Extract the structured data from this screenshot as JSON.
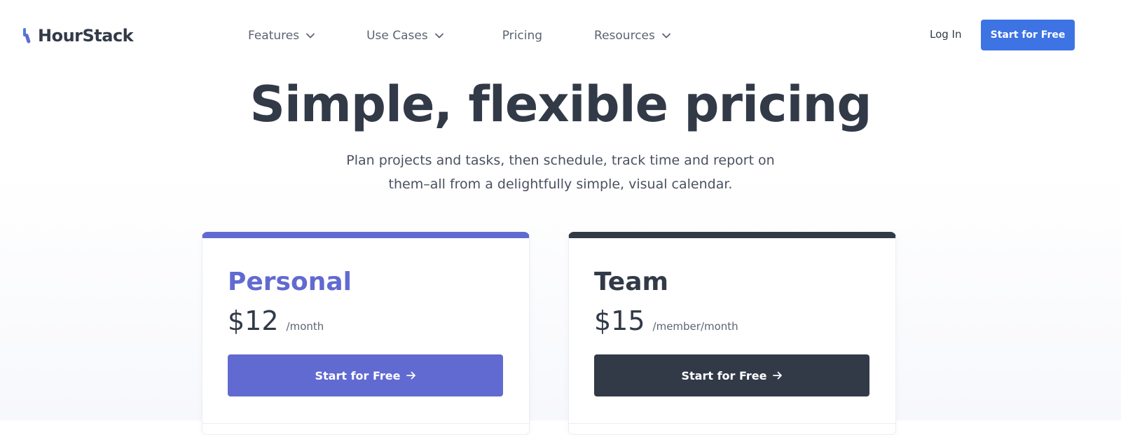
{
  "header": {
    "logo_text": "HourStack",
    "nav": [
      {
        "label": "Features",
        "has_dropdown": true
      },
      {
        "label": "Use Cases",
        "has_dropdown": true
      },
      {
        "label": "Pricing",
        "has_dropdown": false
      },
      {
        "label": "Resources",
        "has_dropdown": true
      }
    ],
    "login_label": "Log In",
    "cta_label": "Start for Free"
  },
  "hero": {
    "title": "Simple, flexible pricing",
    "subtitle_line1": "Plan projects and tasks, then schedule, track time and report on",
    "subtitle_line2": "them–all from a delightfully simple, visual calendar."
  },
  "plans": [
    {
      "name": "Personal",
      "price": "$12",
      "period": "/month",
      "button_label": "Start for Free",
      "accent": "#616ad1"
    },
    {
      "name": "Team",
      "price": "$15",
      "period": "/member/month",
      "button_label": "Start for Free",
      "accent": "#323a48"
    }
  ],
  "colors": {
    "brand_blue": "#3e73e4",
    "personal_accent": "#616ad1",
    "team_accent": "#323a48",
    "text_dark": "#323a48"
  },
  "icons": {
    "dropdown": "chevron-down-icon",
    "button_arrow": "arrow-right-icon",
    "logo": "hourstack-logo-icon"
  }
}
